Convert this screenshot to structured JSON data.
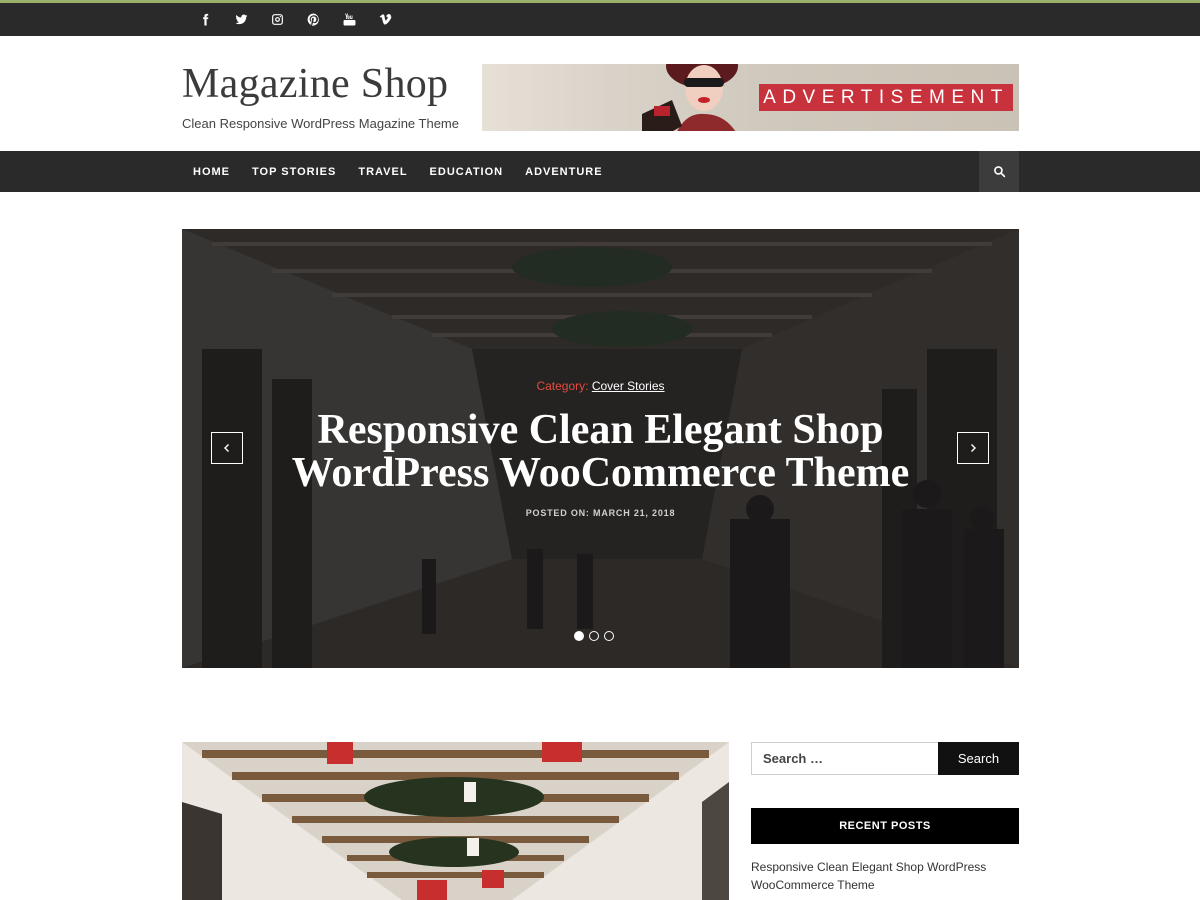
{
  "colors": {
    "top_accent": "#9bb06a",
    "bar_dark": "#2a2a2a",
    "ad_red": "#c8323c",
    "category_red": "#e24c3f"
  },
  "social": [
    "facebook-icon",
    "twitter-icon",
    "instagram-icon",
    "pinterest-icon",
    "youtube-icon",
    "vimeo-icon"
  ],
  "header": {
    "site_title": "Magazine Shop",
    "tagline": "Clean Responsive WordPress Magazine Theme",
    "ad_label": "ADVERTISEMENT"
  },
  "nav": {
    "items": [
      "HOME",
      "TOP STORIES",
      "TRAVEL",
      "EDUCATION",
      "ADVENTURE"
    ],
    "search_icon": "search-icon"
  },
  "slider": {
    "category_prefix": "Category:",
    "category": "Cover Stories",
    "title": "Responsive Clean Elegant Shop WordPress WooCommerce Theme",
    "meta": "POSTED ON: MARCH 21, 2018",
    "slide_count": 3,
    "active_slide": 1
  },
  "sidebar": {
    "search_placeholder": "Search …",
    "search_button": "Search",
    "recent_posts_title": "RECENT POSTS",
    "recent_posts": [
      "Responsive Clean Elegant Shop WordPress WooCommerce Theme"
    ]
  }
}
